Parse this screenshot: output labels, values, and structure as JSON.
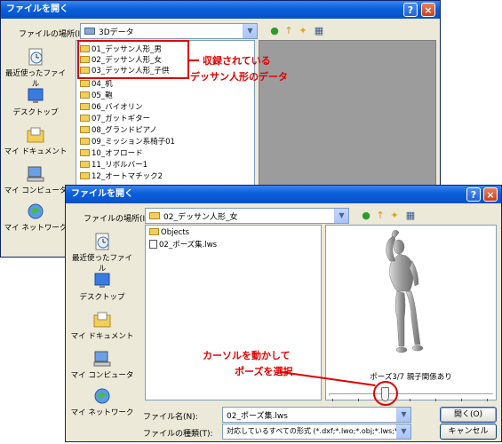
{
  "dialog1": {
    "title": "ファイルを開く",
    "lookin_label": "ファイルの場所(I):",
    "lookin_value": "3Dデータ",
    "places": [
      "最近使ったファイル",
      "デスクトップ",
      "マイ ドキュメント",
      "マイ コンピュータ",
      "マイ ネットワーク"
    ],
    "items": [
      "01_デッサン人形_男",
      "02_デッサン人形_女",
      "03_デッサン人形_子供",
      "04_机",
      "05_鞄",
      "06_バイオリン",
      "07_ガットギター",
      "08_グランドピアノ",
      "09_ミッション系椅子01",
      "10_オフロード",
      "11_リボルバー1",
      "12_オートマチック2"
    ]
  },
  "dialog2": {
    "title": "ファイルを開く",
    "lookin_label": "ファイルの場所(I):",
    "lookin_value": "02_デッサン人形_女",
    "places": [
      "最近使ったファイル",
      "デスクトップ",
      "マイ ドキュメント",
      "マイ コンピュータ",
      "マイ ネットワーク"
    ],
    "items": [
      "Objects",
      "02_ポーズ集.lws"
    ],
    "preview_caption": "ポーズ3/7 親子関係あり",
    "pose_current": 3,
    "pose_total": 7,
    "filename_label": "ファイル名(N):",
    "filename_value": "02_ポーズ集.lws",
    "filetype_label": "ファイルの種類(T):",
    "filetype_value": "対応しているすべての形式 (*.dxf;*.lwo;*.obj;*.lws;*.cso",
    "open_button": "開く(O)",
    "cancel_button": "キャンセル"
  },
  "annotations": {
    "note1_line1": "収録されている",
    "note1_line2": "デッサン人形のデータ",
    "note2_line1": "カーソルを動かして",
    "note2_line2": "ポーズを選択"
  },
  "colors": {
    "annotation": "#e00000",
    "titlebar": "#0a5fd8"
  }
}
